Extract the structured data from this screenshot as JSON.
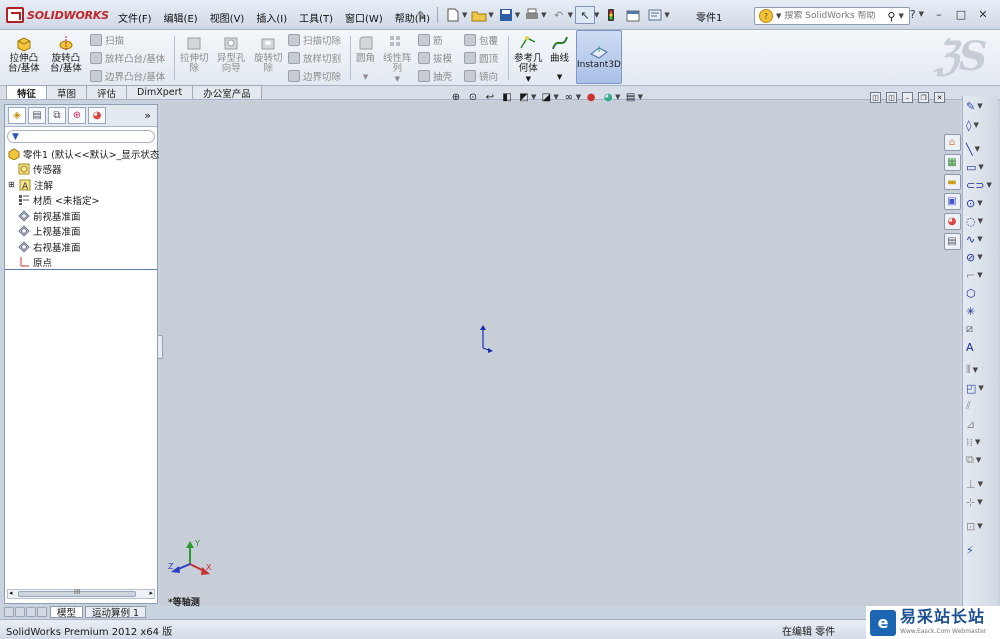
{
  "app": {
    "title": "SOLIDWORKS",
    "document_title": "零件1"
  },
  "menu": [
    "文件(F)",
    "编辑(E)",
    "视图(V)",
    "插入(I)",
    "工具(T)",
    "窗口(W)",
    "帮助(H)"
  ],
  "search": {
    "placeholder": "搜索 SolidWorks 帮助"
  },
  "command_manager": {
    "extruded_boss": "拉伸凸\n台/基体",
    "revolved_boss": "旋转凸\n台/基体",
    "sweep": "扫描",
    "loft_boss": "放样凸台/基体",
    "boundary_boss": "边界凸台/基体",
    "extruded_cut": "拉伸切\n除",
    "hole_wizard": "异型孔\n向导",
    "revolved_cut": "旋转切\n除",
    "swept_cut": "扫描切除",
    "lofted_cut": "放样切割",
    "boundary_cut": "边界切除",
    "fillet": "圆角",
    "linear_pattern": "线性阵\n列",
    "rib": "筋",
    "draft": "拔模",
    "shell": "抽壳",
    "wrap": "包覆",
    "dome": "圆顶",
    "mirror": "镜向",
    "reference_geometry": "参考几\n何体",
    "curves": "曲线",
    "instant3d": "Instant3D"
  },
  "tabs": [
    "特征",
    "草图",
    "评估",
    "DimXpert",
    "办公室产品"
  ],
  "feature_tree": {
    "root": "零件1 (默认<<默认>_显示状态",
    "items": [
      "传感器",
      "注解",
      "材质 <未指定>",
      "前视基准面",
      "上视基准面",
      "右视基准面",
      "原点"
    ]
  },
  "scroll_label": "III",
  "bottom_tabs": [
    "模型",
    "运动算例 1"
  ],
  "status": {
    "left": "SolidWorks Premium 2012 x64 版",
    "right": "在编辑 零件"
  },
  "view_label": "*等轴测",
  "triad": {
    "x": "X",
    "y": "Y",
    "z": "Z"
  },
  "watermark": {
    "text": "易采站长站",
    "sub": "Www.Easck.Com Webmaster"
  },
  "colors": {
    "accent": "#c2262a",
    "viewport": "#c8ced8",
    "highlight": "#a9c0e6"
  }
}
